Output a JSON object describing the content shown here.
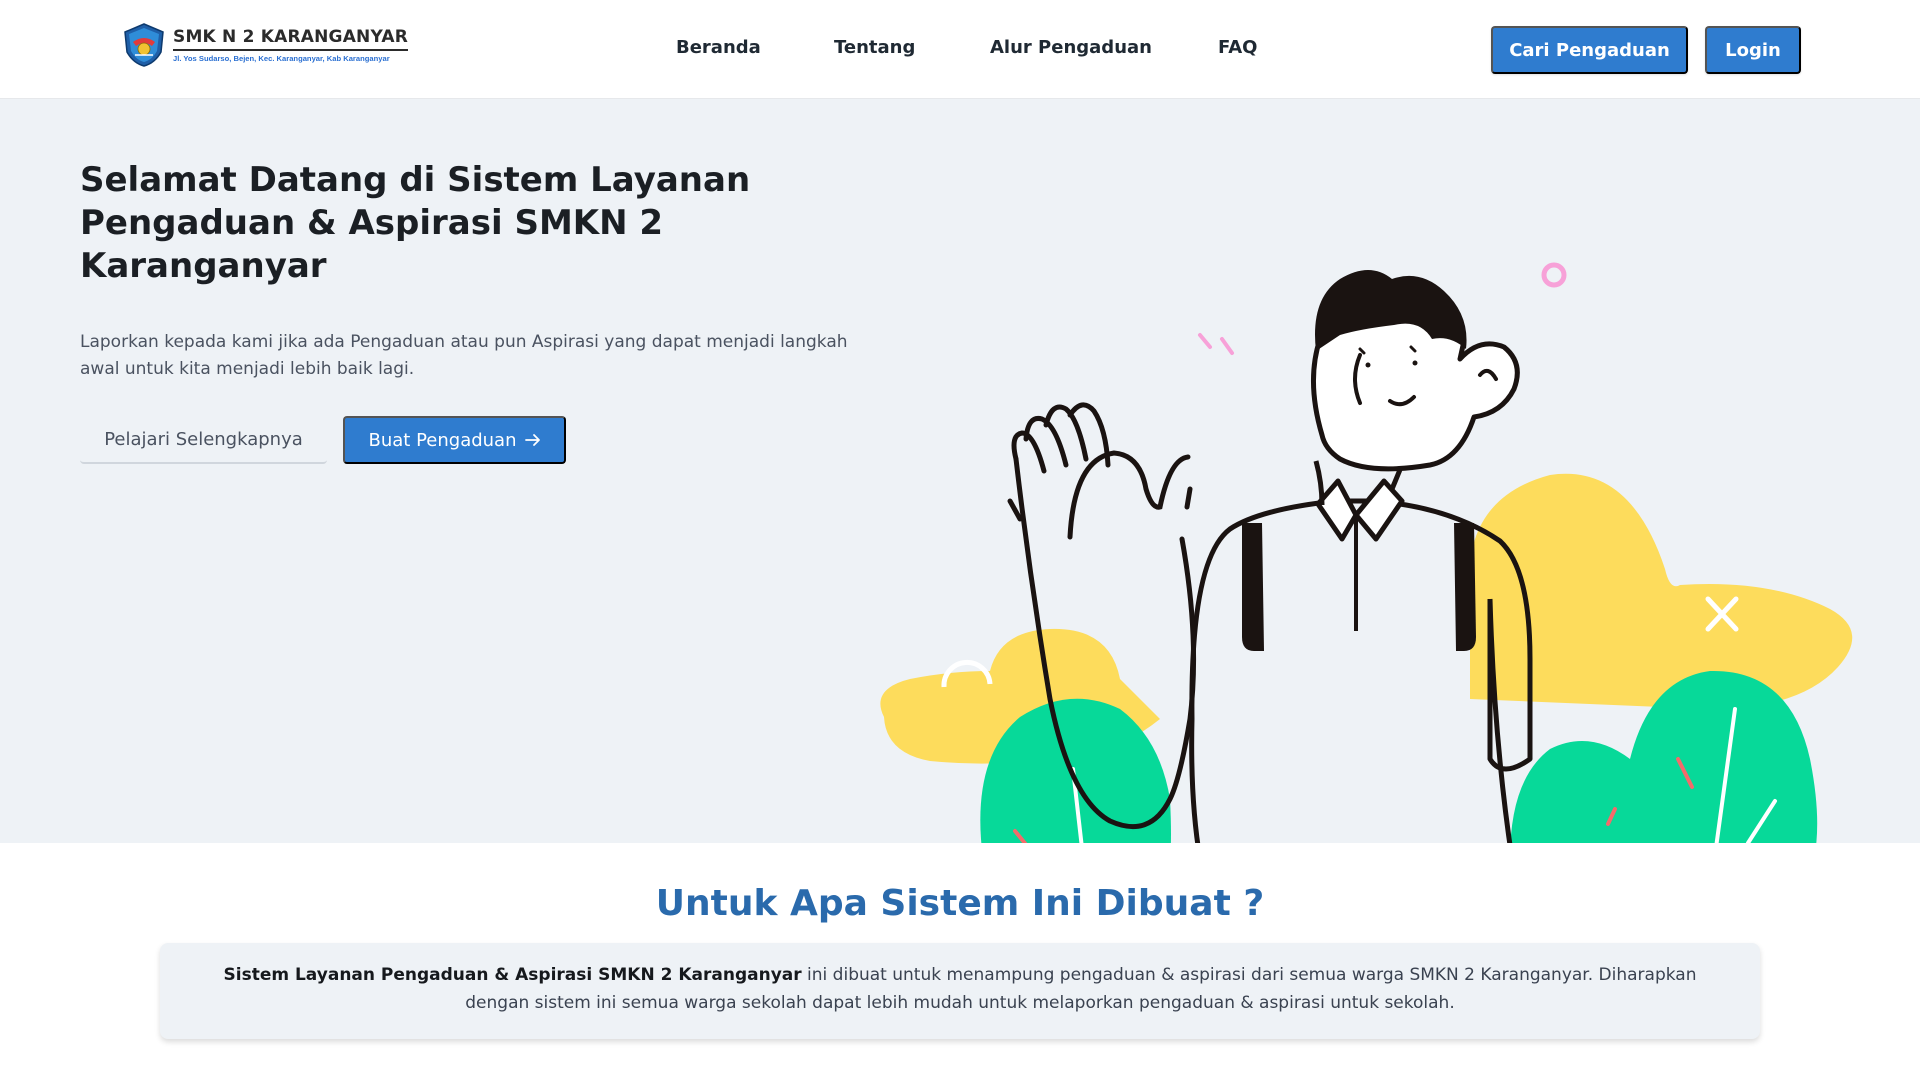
{
  "brand": {
    "name": "SMK N 2 KARANGANYAR",
    "address": "Jl. Yos Sudarso, Bejen, Kec. Karanganyar, Kab Karanganyar",
    "logo_icon": "school-emblem-icon"
  },
  "nav": {
    "items": [
      {
        "label": "Beranda"
      },
      {
        "label": "Tentang"
      },
      {
        "label": "Alur Pengaduan"
      },
      {
        "label": "FAQ"
      }
    ],
    "search_button": "Cari Pengaduan",
    "login_button": "Login"
  },
  "hero": {
    "title": "Selamat Datang di Sistem Layanan Pengaduan & Aspirasi SMKN 2 Karanganyar",
    "text": "Laporkan kepada kami jika ada Pengaduan atau pun Aspirasi yang dapat menjadi langkah awal untuk kita menjadi lebih baik lagi.",
    "learn_more": "Pelajari Selengkapnya",
    "create_button": "Buat Pengaduan",
    "create_button_icon": "arrow-right-icon"
  },
  "about": {
    "title": "Untuk Apa Sistem Ini Dibuat ?",
    "highlight": "Sistem Layanan Pengaduan & Aspirasi SMKN 2 Karanganyar",
    "body": " ini dibuat untuk menampung pengaduan & aspirasi dari semua warga SMKN 2 Karanganyar. Diharapkan dengan sistem ini semua warga sekolah dapat lebih mudah untuk melaporkan pengaduan & aspirasi untuk sekolah."
  },
  "colors": {
    "primary": "#2f7ccf",
    "hero_bg": "#eef2f6",
    "heading_blue": "#2a6aac",
    "yellow_blob": "#fddc5c",
    "green_bush": "#07d999",
    "pink_accent": "#f7a1d8"
  }
}
